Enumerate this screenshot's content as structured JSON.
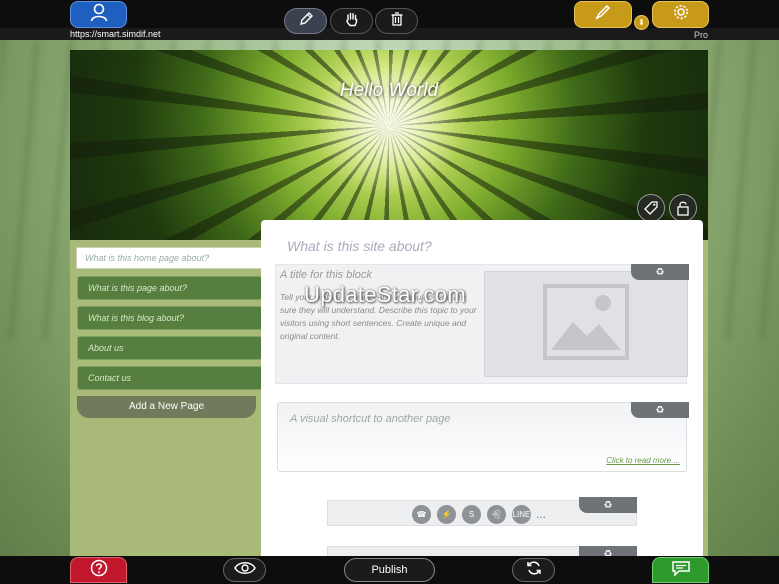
{
  "top_bar": {
    "url": "https://smart.simdif.net",
    "plan": "Pro",
    "icons": {
      "user": "user-icon",
      "edit": "pencil-icon",
      "move": "hand-icon",
      "delete": "trash-icon",
      "design": "paintbrush-icon",
      "settings": "gear-icon",
      "download": "download-icon"
    }
  },
  "header": {
    "site_title": "Hello World",
    "tag_icon": "tag-icon",
    "lock_icon": "lock-icon"
  },
  "sidebar": {
    "home_placeholder": "What is this home page about?",
    "nav_items": [
      {
        "label": "What is this page about?"
      },
      {
        "label": "What is this blog about?"
      },
      {
        "label": "About us"
      },
      {
        "label": "Contact us"
      }
    ],
    "add_page_label": "Add a New Page"
  },
  "main": {
    "site_about_placeholder": "What is this site about?",
    "block1": {
      "title": "A title for this block",
      "text": "Tell your visitors ... words and vocabulary you are sure they will understand. Describe this topic to your visitors using short sentences. Create unique and original content."
    },
    "shortcut": {
      "text": "A visual shortcut to another page",
      "read_more": "Click to read more ..."
    },
    "social_more": "..."
  },
  "watermark": "UpdateStar.com",
  "bottom_bar": {
    "publish_label": "Publish",
    "icons": {
      "help": "question-icon",
      "preview": "eye-icon",
      "sync": "refresh-icon",
      "chat": "chat-icon"
    }
  },
  "colors": {
    "user_button": "#1f5fbf",
    "gold_button": "#c89a1a",
    "help_button": "#c2182e",
    "chat_button": "#2e9a2e",
    "nav_item": "#557e3f",
    "site_background": "#a8b978"
  }
}
